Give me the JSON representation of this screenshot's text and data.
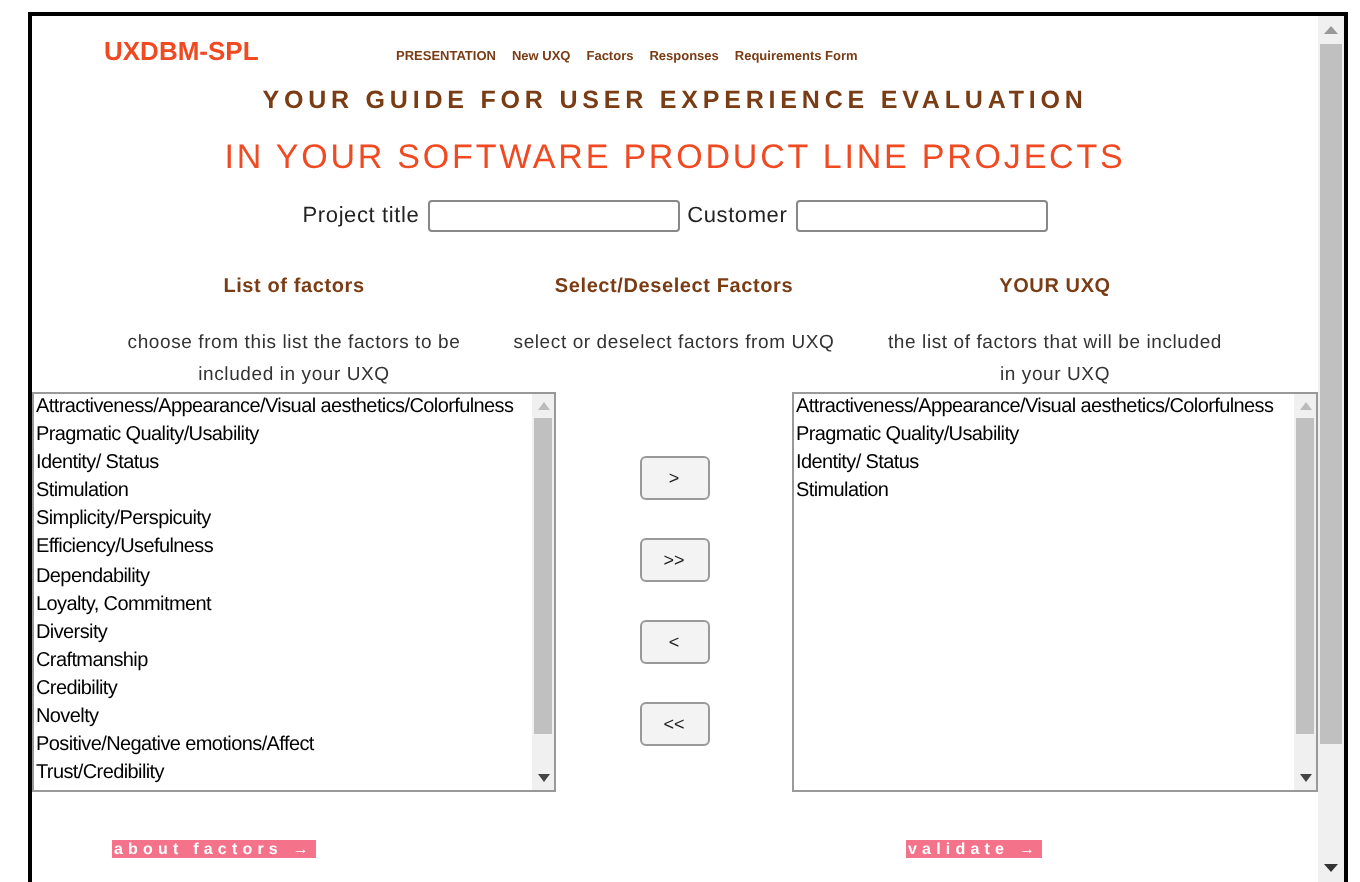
{
  "logo": "UXDBM-SPL",
  "nav": [
    "PRESENTATION",
    "New UXQ",
    "Factors",
    "Responses",
    "Requirements Form"
  ],
  "heading": "YOUR GUIDE FOR USER EXPERIENCE EVALUATION",
  "subheading": "IN YOUR SOFTWARE PRODUCT LINE PROJECTS",
  "fields": [
    {
      "label": "Project title"
    },
    {
      "label": "Customer"
    }
  ],
  "columns": [
    {
      "title": "List of factors",
      "hint": "choose from this list the factors to be included in your UXQ"
    },
    {
      "title": "Select/Deselect Factors",
      "hint": "select or deselect factors from UXQ"
    },
    {
      "title": "YOUR UXQ",
      "hint": "the list of factors that will be included in your UXQ"
    }
  ],
  "factors": [
    "Attractiveness/Appearance/Visual aesthetics/Colorfulness",
    "Pragmatic Quality/Usability",
    "Identity/ Status",
    "Stimulation",
    "Simplicity/Perspicuity",
    "Efficiency/Usefulness",
    "Dependability",
    "Loyalty, Commitment",
    "Diversity",
    "Craftmanship",
    "Credibility",
    "Novelty",
    "Positive/Negative emotions/Affect",
    "Trust/Credibility"
  ],
  "move_buttons": [
    ">",
    ">>",
    "<",
    "<<"
  ],
  "uxq": [
    "Attractiveness/Appearance/Visual aesthetics/Colorfulness",
    "Pragmatic Quality/Usability",
    "Identity/ Status",
    "Stimulation"
  ],
  "links": [
    "about factors →",
    "validate →"
  ]
}
